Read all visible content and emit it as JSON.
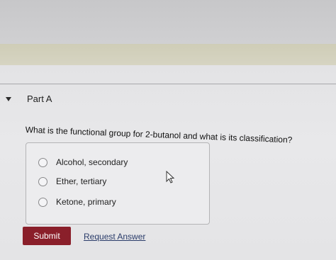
{
  "part": {
    "title": "Part A"
  },
  "question": {
    "text": "What is the functional group for 2-butanol and what is its classification?"
  },
  "choices": [
    {
      "label": "Alcohol, secondary"
    },
    {
      "label": "Ether, tertiary"
    },
    {
      "label": "Ketone, primary"
    }
  ],
  "actions": {
    "submit_label": "Submit",
    "request_label": "Request Answer"
  },
  "colors": {
    "submit_bg": "#8a1f2a",
    "link": "#2a3c6a"
  }
}
